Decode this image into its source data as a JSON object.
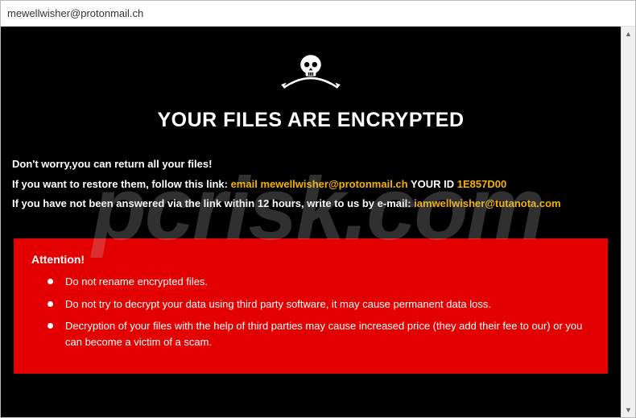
{
  "window": {
    "title": "mewellwisher@protonmail.ch"
  },
  "heading": "YOUR FILES ARE ENCRYPTED",
  "lines": {
    "l1": "Don't worry,you can return all your files!",
    "l2a": "If you want to restore them, follow this link: ",
    "l2_email_prefix": "email ",
    "l2_email": "mewellwisher@protonmail.ch",
    "l2_yourid": "  YOUR ID ",
    "l2_id": "1E857D00",
    "l3a": "If you have not been answered via the link within 12 hours, write to us by e-mail: ",
    "l3_email": "iamwellwisher@tutanota.com"
  },
  "attention": {
    "title": "Attention!",
    "items": [
      "Do not rename encrypted files.",
      "Do not try to decrypt your data using third party software, it may cause permanent data loss.",
      "Decryption of your files with the help of third parties may cause increased price (they add their fee to our) or you can become a victim of a scam."
    ]
  },
  "watermark": "pcrisk.com",
  "scroll": {
    "up": "▲",
    "down": "▼"
  }
}
